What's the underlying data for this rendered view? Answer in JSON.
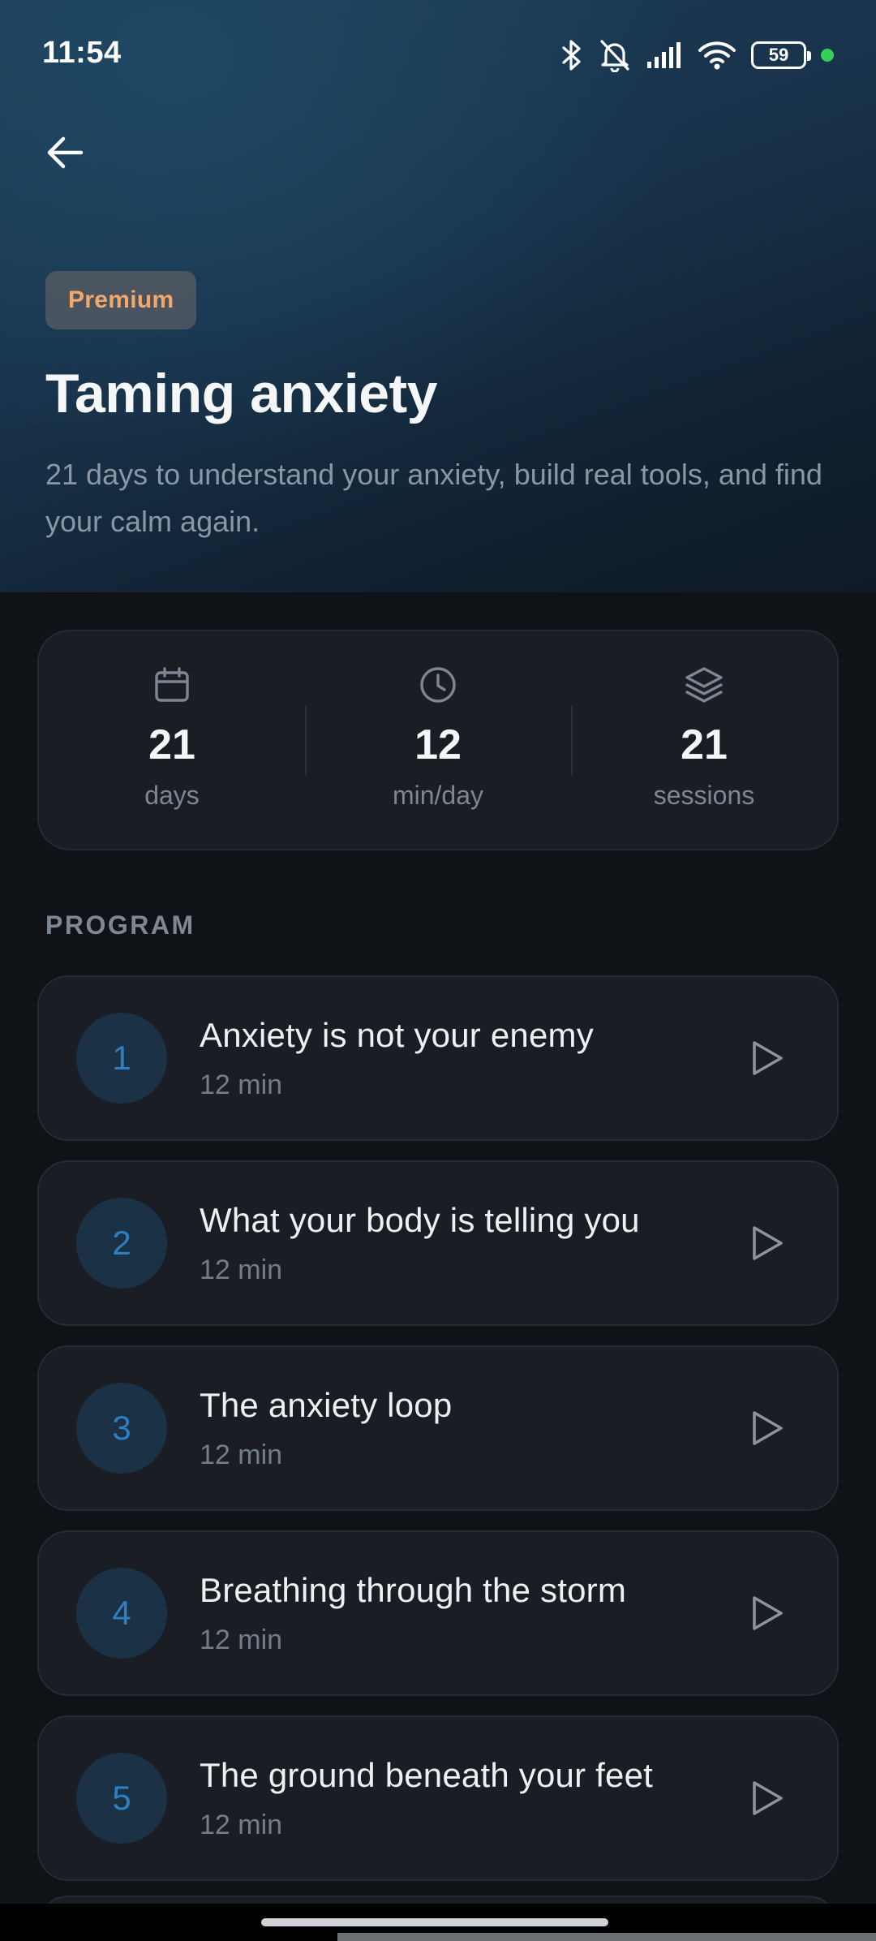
{
  "status_bar": {
    "time": "11:54",
    "battery": "59",
    "icons": [
      "bluetooth-icon",
      "bell-off-icon",
      "signal-icon",
      "wifi-icon",
      "battery-icon",
      "green-dot"
    ]
  },
  "header": {
    "back_icon": "arrow-left-icon",
    "badge": "Premium",
    "title": "Taming anxiety",
    "subtitle": "21 days to understand your anxiety, build real tools, and find your calm again."
  },
  "stats": [
    {
      "icon": "calendar-icon",
      "value": "21",
      "label": "days"
    },
    {
      "icon": "clock-icon",
      "value": "12",
      "label": "min/day"
    },
    {
      "icon": "layers-icon",
      "value": "21",
      "label": "sessions"
    }
  ],
  "program": {
    "section_label": "PROGRAM",
    "lessons": [
      {
        "number": "1",
        "title": "Anxiety is not your enemy",
        "duration": "12 min"
      },
      {
        "number": "2",
        "title": "What your body is telling you",
        "duration": "12 min"
      },
      {
        "number": "3",
        "title": "The anxiety loop",
        "duration": "12 min"
      },
      {
        "number": "4",
        "title": "Breathing through the storm",
        "duration": "12 min"
      },
      {
        "number": "5",
        "title": "The ground beneath your feet",
        "duration": "12 min"
      }
    ]
  },
  "colors": {
    "background": "#0f1217",
    "card": "#1a1e24",
    "badge_text": "#f3a86a",
    "accent_blue": "#2f7fbf",
    "number_circle": "#1b3246"
  }
}
